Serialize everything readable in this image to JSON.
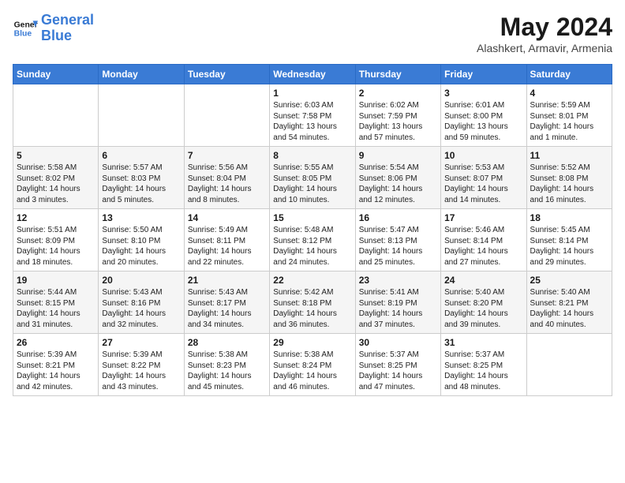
{
  "logo": {
    "line1": "General",
    "line2": "Blue"
  },
  "title": "May 2024",
  "location": "Alashkert, Armavir, Armenia",
  "weekdays": [
    "Sunday",
    "Monday",
    "Tuesday",
    "Wednesday",
    "Thursday",
    "Friday",
    "Saturday"
  ],
  "weeks": [
    [
      {
        "day": "",
        "info": ""
      },
      {
        "day": "",
        "info": ""
      },
      {
        "day": "",
        "info": ""
      },
      {
        "day": "1",
        "info": "Sunrise: 6:03 AM\nSunset: 7:58 PM\nDaylight: 13 hours and 54 minutes."
      },
      {
        "day": "2",
        "info": "Sunrise: 6:02 AM\nSunset: 7:59 PM\nDaylight: 13 hours and 57 minutes."
      },
      {
        "day": "3",
        "info": "Sunrise: 6:01 AM\nSunset: 8:00 PM\nDaylight: 13 hours and 59 minutes."
      },
      {
        "day": "4",
        "info": "Sunrise: 5:59 AM\nSunset: 8:01 PM\nDaylight: 14 hours and 1 minute."
      }
    ],
    [
      {
        "day": "5",
        "info": "Sunrise: 5:58 AM\nSunset: 8:02 PM\nDaylight: 14 hours and 3 minutes."
      },
      {
        "day": "6",
        "info": "Sunrise: 5:57 AM\nSunset: 8:03 PM\nDaylight: 14 hours and 5 minutes."
      },
      {
        "day": "7",
        "info": "Sunrise: 5:56 AM\nSunset: 8:04 PM\nDaylight: 14 hours and 8 minutes."
      },
      {
        "day": "8",
        "info": "Sunrise: 5:55 AM\nSunset: 8:05 PM\nDaylight: 14 hours and 10 minutes."
      },
      {
        "day": "9",
        "info": "Sunrise: 5:54 AM\nSunset: 8:06 PM\nDaylight: 14 hours and 12 minutes."
      },
      {
        "day": "10",
        "info": "Sunrise: 5:53 AM\nSunset: 8:07 PM\nDaylight: 14 hours and 14 minutes."
      },
      {
        "day": "11",
        "info": "Sunrise: 5:52 AM\nSunset: 8:08 PM\nDaylight: 14 hours and 16 minutes."
      }
    ],
    [
      {
        "day": "12",
        "info": "Sunrise: 5:51 AM\nSunset: 8:09 PM\nDaylight: 14 hours and 18 minutes."
      },
      {
        "day": "13",
        "info": "Sunrise: 5:50 AM\nSunset: 8:10 PM\nDaylight: 14 hours and 20 minutes."
      },
      {
        "day": "14",
        "info": "Sunrise: 5:49 AM\nSunset: 8:11 PM\nDaylight: 14 hours and 22 minutes."
      },
      {
        "day": "15",
        "info": "Sunrise: 5:48 AM\nSunset: 8:12 PM\nDaylight: 14 hours and 24 minutes."
      },
      {
        "day": "16",
        "info": "Sunrise: 5:47 AM\nSunset: 8:13 PM\nDaylight: 14 hours and 25 minutes."
      },
      {
        "day": "17",
        "info": "Sunrise: 5:46 AM\nSunset: 8:14 PM\nDaylight: 14 hours and 27 minutes."
      },
      {
        "day": "18",
        "info": "Sunrise: 5:45 AM\nSunset: 8:14 PM\nDaylight: 14 hours and 29 minutes."
      }
    ],
    [
      {
        "day": "19",
        "info": "Sunrise: 5:44 AM\nSunset: 8:15 PM\nDaylight: 14 hours and 31 minutes."
      },
      {
        "day": "20",
        "info": "Sunrise: 5:43 AM\nSunset: 8:16 PM\nDaylight: 14 hours and 32 minutes."
      },
      {
        "day": "21",
        "info": "Sunrise: 5:43 AM\nSunset: 8:17 PM\nDaylight: 14 hours and 34 minutes."
      },
      {
        "day": "22",
        "info": "Sunrise: 5:42 AM\nSunset: 8:18 PM\nDaylight: 14 hours and 36 minutes."
      },
      {
        "day": "23",
        "info": "Sunrise: 5:41 AM\nSunset: 8:19 PM\nDaylight: 14 hours and 37 minutes."
      },
      {
        "day": "24",
        "info": "Sunrise: 5:40 AM\nSunset: 8:20 PM\nDaylight: 14 hours and 39 minutes."
      },
      {
        "day": "25",
        "info": "Sunrise: 5:40 AM\nSunset: 8:21 PM\nDaylight: 14 hours and 40 minutes."
      }
    ],
    [
      {
        "day": "26",
        "info": "Sunrise: 5:39 AM\nSunset: 8:21 PM\nDaylight: 14 hours and 42 minutes."
      },
      {
        "day": "27",
        "info": "Sunrise: 5:39 AM\nSunset: 8:22 PM\nDaylight: 14 hours and 43 minutes."
      },
      {
        "day": "28",
        "info": "Sunrise: 5:38 AM\nSunset: 8:23 PM\nDaylight: 14 hours and 45 minutes."
      },
      {
        "day": "29",
        "info": "Sunrise: 5:38 AM\nSunset: 8:24 PM\nDaylight: 14 hours and 46 minutes."
      },
      {
        "day": "30",
        "info": "Sunrise: 5:37 AM\nSunset: 8:25 PM\nDaylight: 14 hours and 47 minutes."
      },
      {
        "day": "31",
        "info": "Sunrise: 5:37 AM\nSunset: 8:25 PM\nDaylight: 14 hours and 48 minutes."
      },
      {
        "day": "",
        "info": ""
      }
    ]
  ]
}
